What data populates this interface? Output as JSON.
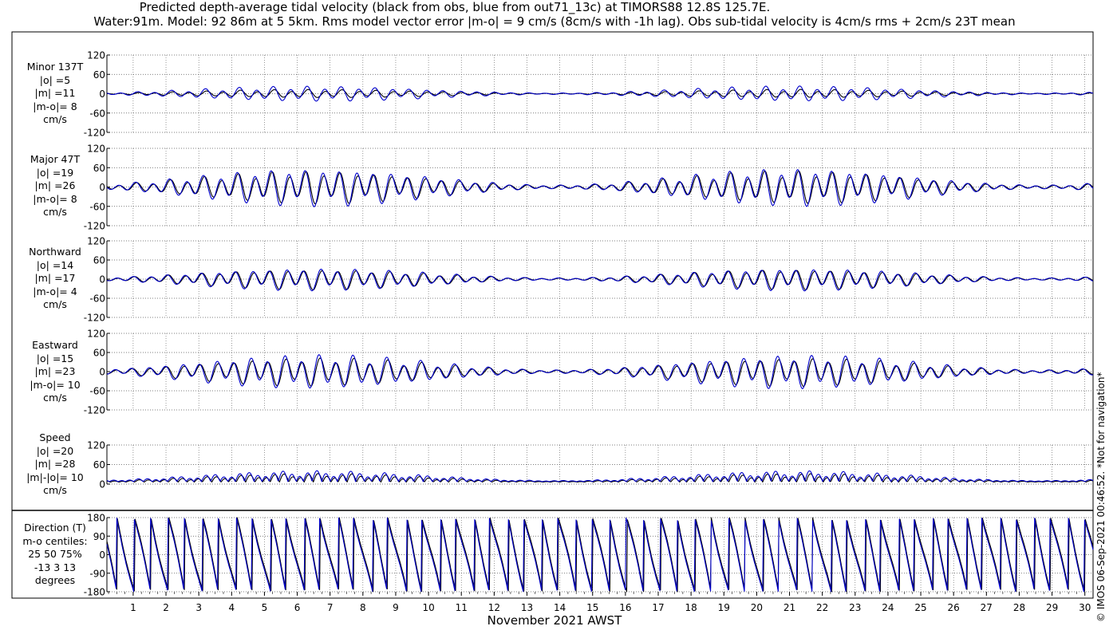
{
  "header": {
    "title_line1": "Predicted depth-average tidal velocity (black from obs, blue from out71_13c) at TIMORS88 12.8S 125.7E.",
    "title_line2": "Water:91m. Model: 92 86m at 5 5km. Rms model vector error |m-o| = 9 cm/s (8cm/s with -1h lag). Obs sub-tidal velocity is 4cm/s rms + 2cm/s 23T mean"
  },
  "xaxis": {
    "label": "November 2021 AWST",
    "ticks": [
      "1",
      "2",
      "3",
      "4",
      "5",
      "6",
      "7",
      "8",
      "9",
      "10",
      "11",
      "12",
      "13",
      "14",
      "15",
      "16",
      "17",
      "18",
      "19",
      "20",
      "21",
      "22",
      "23",
      "24",
      "25",
      "26",
      "27",
      "28",
      "29",
      "30"
    ]
  },
  "copyright": "© IMOS 06-Sep-2021 00:46:52. *Not for navigation*",
  "colors": {
    "obs": "#000000",
    "model": "#0000cc",
    "grid": "#555555"
  },
  "panels": [
    {
      "label_lines": [
        "Minor 137T",
        "|o| =5",
        "|m| =11",
        "|m-o|= 8",
        "cm/s"
      ]
    },
    {
      "label_lines": [
        "Major 47T",
        "|o| =19",
        "|m| =26",
        "|m-o|= 8",
        "cm/s"
      ]
    },
    {
      "label_lines": [
        "Northward",
        "|o| =14",
        "|m| =17",
        "|m-o|= 4",
        "cm/s"
      ]
    },
    {
      "label_lines": [
        "Eastward",
        "|o| =15",
        "|m| =23",
        "|m-o|= 10",
        "cm/s"
      ]
    },
    {
      "label_lines": [
        "Speed",
        "|o| =20",
        "|m| =28",
        "|m|-|o|= 10",
        "cm/s"
      ]
    },
    {
      "label_lines": [
        "Direction (T)",
        "m-o centiles:",
        "25  50  75%",
        "-13   3  13",
        "degrees"
      ]
    }
  ],
  "chart_data": [
    {
      "type": "line",
      "ylim": [
        -120,
        120
      ],
      "yticks": [
        "120",
        "60",
        "0",
        "-60",
        "-120"
      ],
      "series": [
        {
          "amplitude": 12,
          "mean": 0
        },
        {
          "amplitude": 22,
          "mean": 0
        }
      ]
    },
    {
      "type": "line",
      "ylim": [
        -120,
        120
      ],
      "yticks": [
        "120",
        "60",
        "0",
        "-60",
        "-120"
      ],
      "series": [
        {
          "amplitude": 48,
          "mean": 0
        },
        {
          "amplitude": 55,
          "mean": 0
        }
      ]
    },
    {
      "type": "line",
      "ylim": [
        -120,
        120
      ],
      "yticks": [
        "120",
        "60",
        "0",
        "-60",
        "-120"
      ],
      "series": [
        {
          "amplitude": 30,
          "mean": 0
        },
        {
          "amplitude": 33,
          "mean": 0
        }
      ]
    },
    {
      "type": "line",
      "ylim": [
        -120,
        120
      ],
      "yticks": [
        "120",
        "60",
        "0",
        "-60",
        "-120"
      ],
      "series": [
        {
          "amplitude": 42,
          "mean": 0
        },
        {
          "amplitude": 50,
          "mean": 0
        }
      ]
    },
    {
      "type": "line",
      "ylim": [
        0,
        120
      ],
      "yticks": [
        "120",
        "60",
        "0"
      ],
      "series": [
        {
          "amplitude": 24,
          "mean": 20
        },
        {
          "amplitude": 30,
          "mean": 25
        }
      ]
    },
    {
      "type": "line",
      "ylim": [
        -180,
        180
      ],
      "yticks": [
        "180",
        "90",
        "0",
        "-90",
        "-180"
      ],
      "series": [
        {
          "amplitude": 150,
          "mean": 0
        },
        {
          "amplitude": 165,
          "mean": 0
        }
      ]
    }
  ]
}
